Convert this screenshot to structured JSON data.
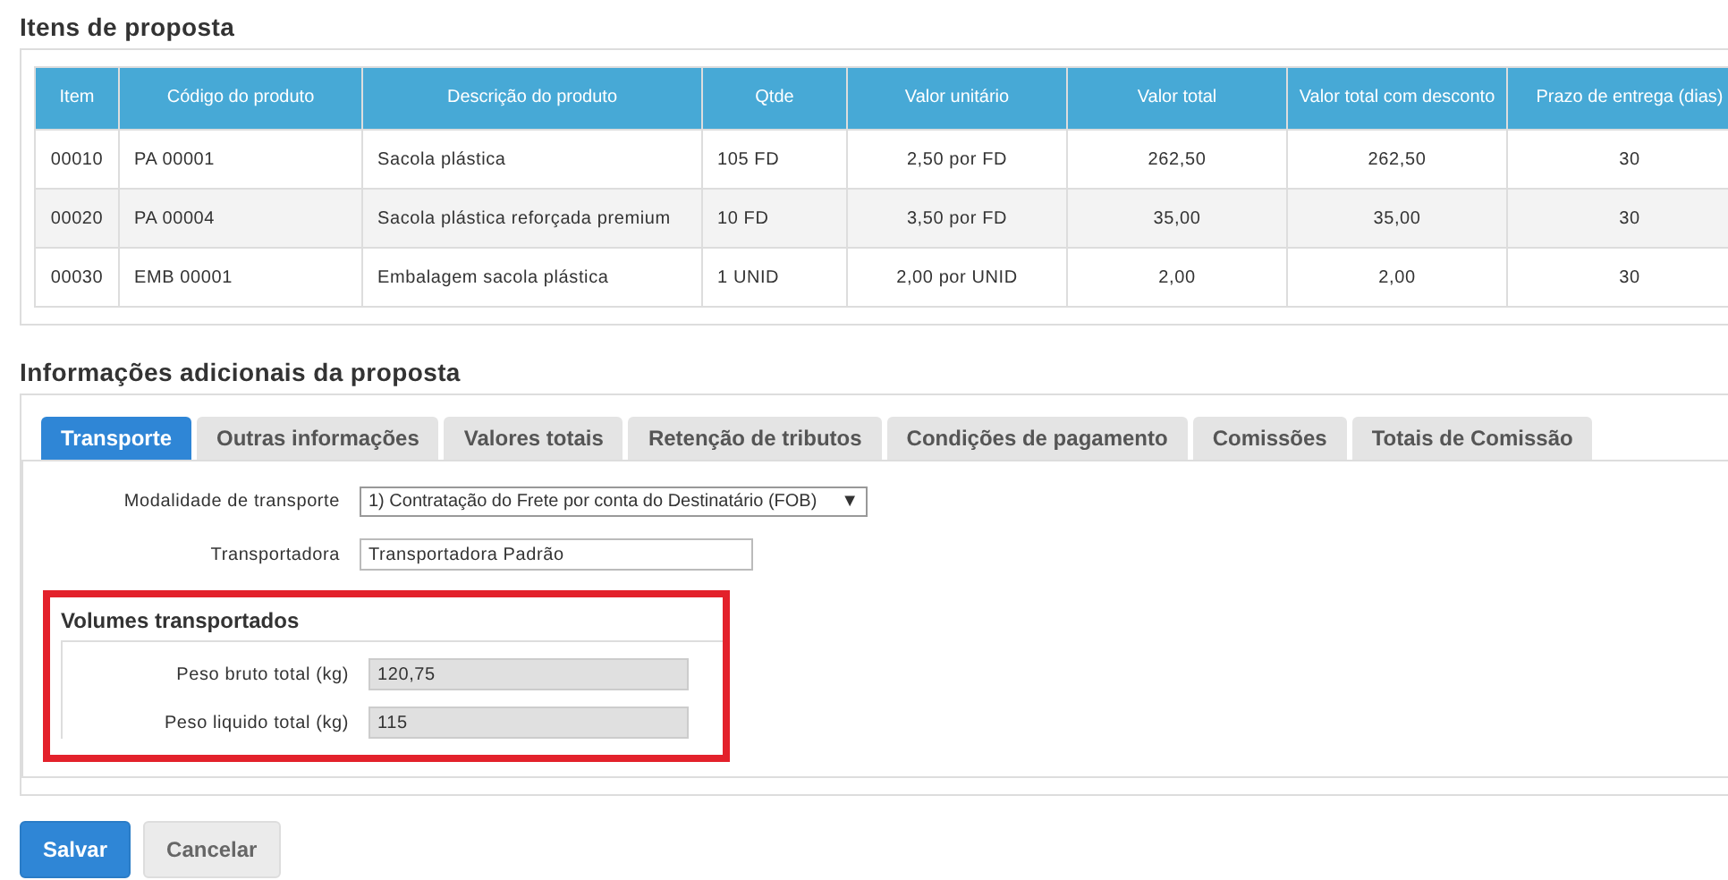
{
  "items_section": {
    "title": "Itens de proposta",
    "columns": [
      "Item",
      "Código do produto",
      "Descrição do produto",
      "Qtde",
      "Valor unitário",
      "Valor total",
      "Valor total com desconto",
      "Prazo de entrega (dias)"
    ],
    "rows": [
      [
        "00010",
        "PA 00001",
        "Sacola plástica",
        "105 FD",
        "2,50 por FD",
        "262,50",
        "262,50",
        "30"
      ],
      [
        "00020",
        "PA 00004",
        "Sacola plástica reforçada premium",
        "10 FD",
        "3,50 por FD",
        "35,00",
        "35,00",
        "30"
      ],
      [
        "00030",
        "EMB 00001",
        "Embalagem sacola plástica",
        "1 UNID",
        "2,00 por UNID",
        "2,00",
        "2,00",
        "30"
      ]
    ]
  },
  "additional_section": {
    "title": "Informações adicionais da proposta",
    "tabs": [
      {
        "label": "Transporte",
        "selected": true
      },
      {
        "label": "Outras informações",
        "selected": false
      },
      {
        "label": "Valores totais",
        "selected": false
      },
      {
        "label": "Retenção de tributos",
        "selected": false
      },
      {
        "label": "Condições de pagamento",
        "selected": false
      },
      {
        "label": "Comissões",
        "selected": false
      },
      {
        "label": "Totais de Comissão",
        "selected": false
      }
    ],
    "fields": [
      {
        "kind": "select",
        "label": "Modalidade de transporte",
        "value": "1) Contratação do Frete por conta do Destinatário (FOB)",
        "arrow": "▼"
      },
      {
        "kind": "text",
        "label": "Transportadora",
        "value": "Transportadora Padrão"
      }
    ],
    "volumes": {
      "title": "Volumes transportados",
      "highlighted": true,
      "fields": [
        {
          "label": "Peso bruto total (kg)",
          "value": "120,75",
          "disabled": true
        },
        {
          "label": "Peso liquido total (kg)",
          "value": "115",
          "disabled": true
        }
      ]
    }
  },
  "buttons": [
    {
      "label": "Salvar",
      "kind": "primary"
    },
    {
      "label": "Cancelar",
      "kind": "default"
    }
  ]
}
